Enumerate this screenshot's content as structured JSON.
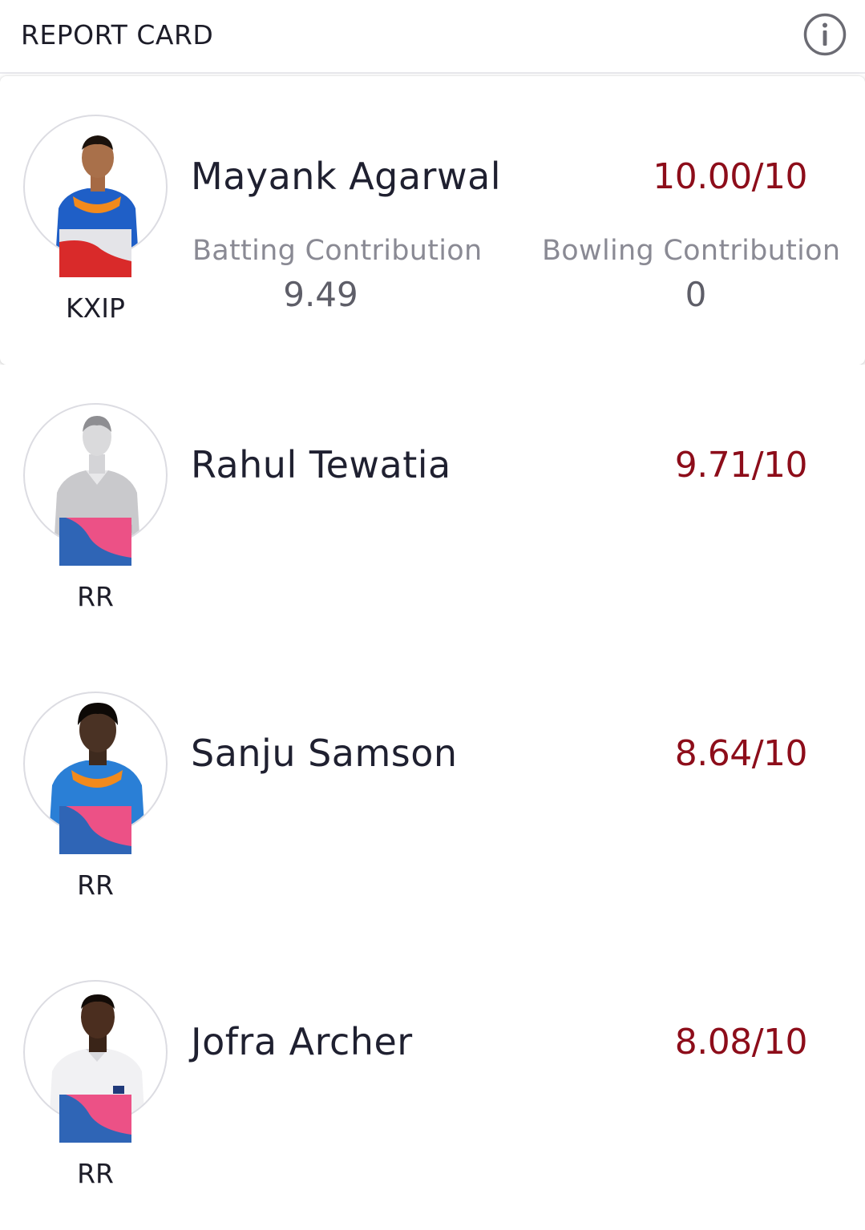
{
  "header": {
    "title": "REPORT CARD",
    "info_icon": "info-icon"
  },
  "colors": {
    "score": "#8d0d1a",
    "kxip_red": "#d92a2a",
    "rr_blue": "#2f65b6",
    "rr_pink": "#ec5186"
  },
  "players": [
    {
      "name": "Mayank Agarwal",
      "score": "10.00/10",
      "team": "KXIP",
      "expanded": true,
      "batting_label": "Batting Contribution",
      "batting_value": "9.49",
      "bowling_label": "Bowling Contribution",
      "bowling_value": "0"
    },
    {
      "name": "Rahul Tewatia",
      "score": "9.71/10",
      "team": "RR",
      "expanded": false
    },
    {
      "name": "Sanju Samson",
      "score": "8.64/10",
      "team": "RR",
      "expanded": false
    },
    {
      "name": "Jofra Archer",
      "score": "8.08/10",
      "team": "RR",
      "expanded": false
    }
  ]
}
